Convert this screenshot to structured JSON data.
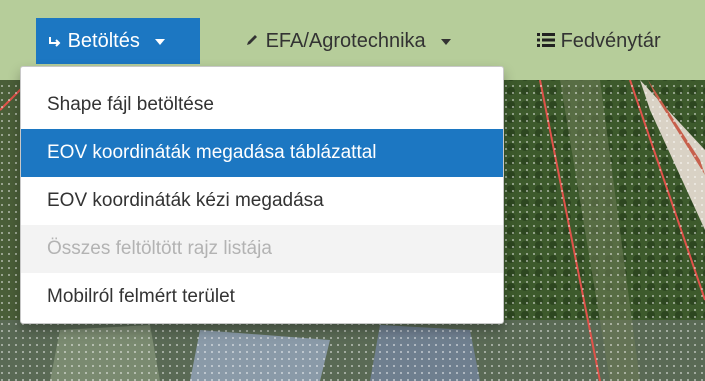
{
  "toolbar": {
    "load_label": "Betöltés",
    "efa_label": "EFA/Agrotechnika",
    "fedveny_label": "Fedvénytár"
  },
  "dropdown": {
    "items": [
      {
        "label": "Shape fájl betöltése",
        "state": "normal"
      },
      {
        "label": "EOV koordináták megadása táblázattal",
        "state": "selected"
      },
      {
        "label": "EOV koordináták kézi megadása",
        "state": "normal"
      },
      {
        "label": "Összes feltöltött rajz listája",
        "state": "disabled"
      },
      {
        "label": "Mobilról felmért terület",
        "state": "normal"
      }
    ]
  },
  "colors": {
    "toolbar_bg": "#b6cd9a",
    "accent": "#1c77c2",
    "parcel_line": "#e0524a"
  }
}
